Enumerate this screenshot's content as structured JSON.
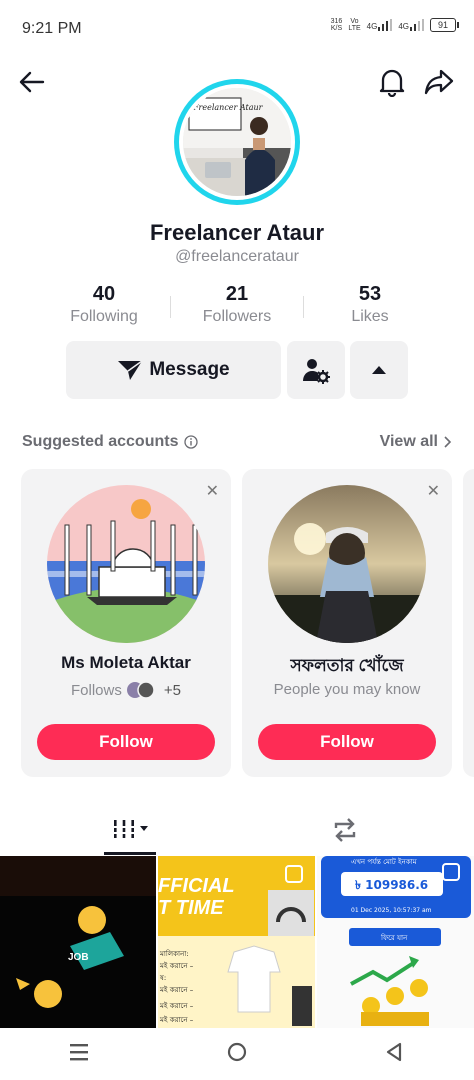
{
  "status_bar": {
    "time": "9:21 PM",
    "network_speed_top": "316",
    "network_speed_bottom": "K/S",
    "vo_top": "Vo",
    "vo_bottom": "LTE",
    "sim1": "4G",
    "sim2": "4G",
    "battery": "91"
  },
  "header": {
    "back_icon": "arrow-left-icon",
    "bell_icon": "bell-icon",
    "share_icon": "share-arrow-icon"
  },
  "profile": {
    "name": "Freelancer Ataur",
    "handle": "@freelancerataur",
    "avatar_caption": "Freelancer Ataur",
    "stats": [
      {
        "value": "40",
        "label": "Following"
      },
      {
        "value": "21",
        "label": "Followers"
      },
      {
        "value": "53",
        "label": "Likes"
      }
    ],
    "message_label": "Message"
  },
  "suggested": {
    "title": "Suggested accounts",
    "view_all": "View all",
    "accounts": [
      {
        "name": "Ms Moleta Aktar",
        "subtitle": "Follows",
        "extra": "+5",
        "follow_label": "Follow"
      },
      {
        "name": "সফলতার খোঁজে",
        "subtitle": "People you may know",
        "follow_label": "Follow"
      }
    ]
  },
  "videos": {
    "thumb1_text": "JOB",
    "thumb2_text_top": "FFICIAL",
    "thumb2_text_bottom": "T TIME",
    "thumb2_lines": [
      "মালিকানা:",
      "মই করানে –",
      "ষ:",
      "মই করানে –",
      "মই করানে –",
      "মই করানে –"
    ],
    "thumb3_header": "এখন পর্যন্ত মোট ইনকাম",
    "thumb3_amount": "৳ 109986.6",
    "thumb3_date": "01 Dec 2025, 10:57:37 am",
    "thumb3_button": "ফিরে যান"
  },
  "colors": {
    "accent": "#fe2c55",
    "ring": "#20d5ec"
  }
}
